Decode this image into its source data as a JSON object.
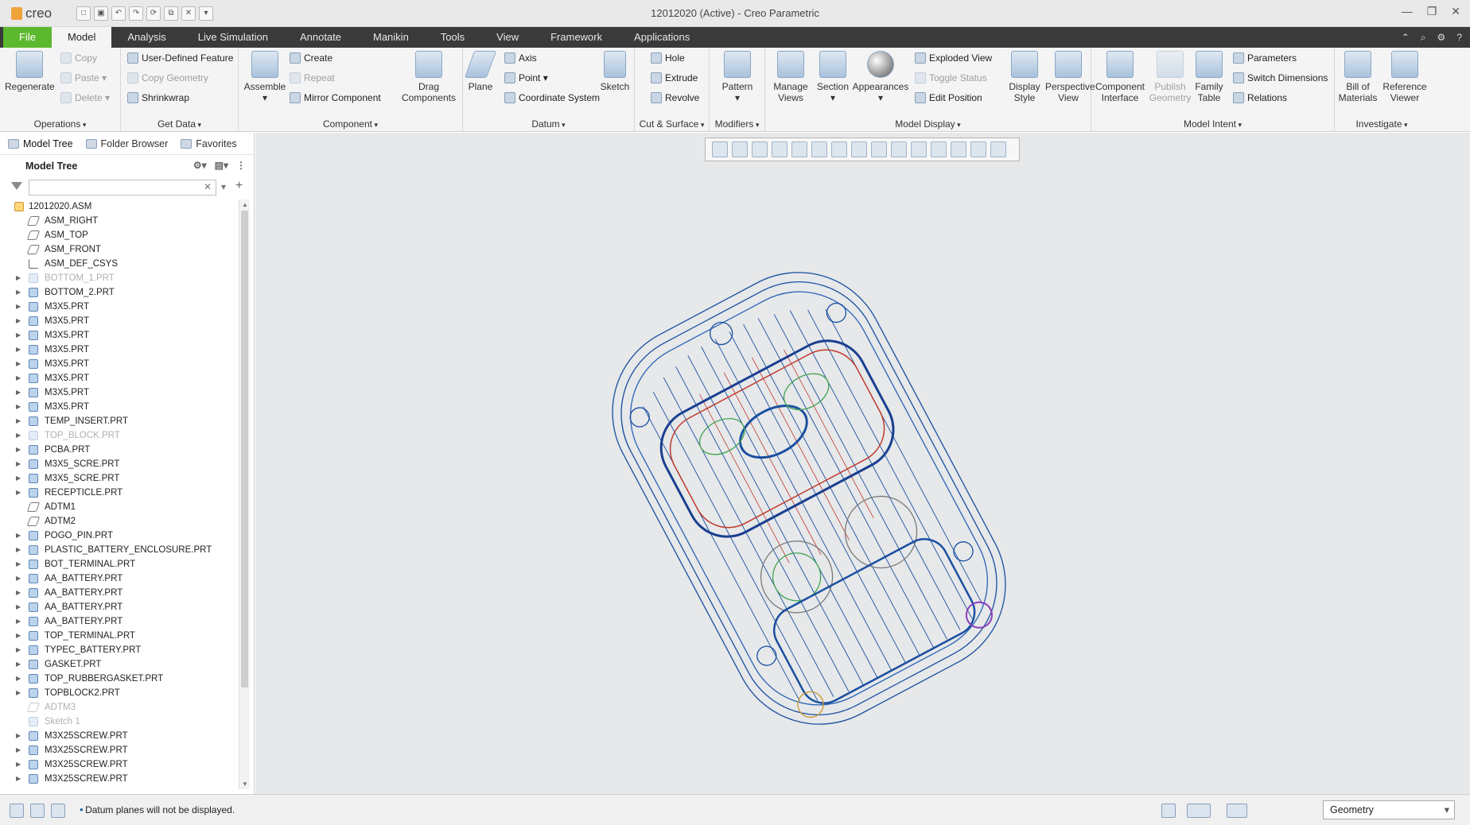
{
  "window": {
    "title": "12012020 (Active) - Creo Parametric",
    "app_name": "creo"
  },
  "tabs": [
    "File",
    "Model",
    "Analysis",
    "Live Simulation",
    "Annotate",
    "Manikin",
    "Tools",
    "View",
    "Framework",
    "Applications"
  ],
  "active_tab": "Model",
  "ribbon": {
    "operations": {
      "label": "Operations",
      "regenerate": "Regenerate",
      "copy": "Copy",
      "paste": "Paste",
      "delete": "Delete"
    },
    "get_data": {
      "label": "Get Data",
      "udf": "User-Defined Feature",
      "copy_geometry": "Copy Geometry",
      "shrinkwrap": "Shrinkwrap"
    },
    "component": {
      "label": "Component",
      "assemble": "Assemble",
      "create": "Create",
      "repeat": "Repeat",
      "mirror": "Mirror Component",
      "drag": "Drag Components"
    },
    "datum": {
      "label": "Datum",
      "plane": "Plane",
      "axis": "Axis",
      "point": "Point",
      "csys": "Coordinate System",
      "sketch": "Sketch"
    },
    "cut_surface": {
      "label": "Cut & Surface",
      "hole": "Hole",
      "extrude": "Extrude",
      "revolve": "Revolve"
    },
    "modifiers": {
      "label": "Modifiers",
      "pattern": "Pattern"
    },
    "model_display": {
      "label": "Model Display",
      "manage_views": "Manage Views",
      "section": "Section",
      "appearances": "Appearances",
      "exploded": "Exploded View",
      "toggle": "Toggle Status",
      "edit_position": "Edit Position",
      "display_style": "Display Style",
      "perspective": "Perspective View"
    },
    "model_intent": {
      "label": "Model Intent",
      "component_interface": "Component Interface",
      "publish_geometry": "Publish Geometry",
      "family_table": "Family Table",
      "parameters": "Parameters",
      "switch_dimensions": "Switch Dimensions",
      "relations": "Relations"
    },
    "investigate": {
      "label": "Investigate",
      "bom": "Bill of Materials",
      "ref_viewer": "Reference Viewer"
    }
  },
  "sidebar": {
    "tabs": [
      "Model Tree",
      "Folder Browser",
      "Favorites"
    ],
    "header": "Model Tree",
    "search_placeholder": "",
    "tree": [
      {
        "label": "12012020.ASM",
        "type": "asm",
        "root": true
      },
      {
        "label": "ASM_RIGHT",
        "type": "plane"
      },
      {
        "label": "ASM_TOP",
        "type": "plane"
      },
      {
        "label": "ASM_FRONT",
        "type": "plane"
      },
      {
        "label": "ASM_DEF_CSYS",
        "type": "csys"
      },
      {
        "label": "BOTTOM_1.PRT",
        "type": "part",
        "dim": true
      },
      {
        "label": "BOTTOM_2.PRT",
        "type": "part"
      },
      {
        "label": "M3X5.PRT",
        "type": "part"
      },
      {
        "label": "M3X5.PRT",
        "type": "part"
      },
      {
        "label": "M3X5.PRT",
        "type": "part"
      },
      {
        "label": "M3X5.PRT",
        "type": "part"
      },
      {
        "label": "M3X5.PRT",
        "type": "part"
      },
      {
        "label": "M3X5.PRT",
        "type": "part"
      },
      {
        "label": "M3X5.PRT",
        "type": "part"
      },
      {
        "label": "M3X5.PRT",
        "type": "part"
      },
      {
        "label": "TEMP_INSERT.PRT",
        "type": "part"
      },
      {
        "label": "TOP_BLOCK.PRT",
        "type": "part",
        "dim": true
      },
      {
        "label": "PCBA.PRT",
        "type": "part"
      },
      {
        "label": "M3X5_SCRE.PRT",
        "type": "part"
      },
      {
        "label": "M3X5_SCRE.PRT",
        "type": "part"
      },
      {
        "label": "RECEPTICLE.PRT",
        "type": "part"
      },
      {
        "label": "ADTM1",
        "type": "plane"
      },
      {
        "label": "ADTM2",
        "type": "plane"
      },
      {
        "label": "POGO_PIN.PRT",
        "type": "part"
      },
      {
        "label": "PLASTIC_BATTERY_ENCLOSURE.PRT",
        "type": "part"
      },
      {
        "label": "BOT_TERMINAL.PRT",
        "type": "part"
      },
      {
        "label": "AA_BATTERY.PRT",
        "type": "part"
      },
      {
        "label": "AA_BATTERY.PRT",
        "type": "part"
      },
      {
        "label": "AA_BATTERY.PRT",
        "type": "part"
      },
      {
        "label": "AA_BATTERY.PRT",
        "type": "part"
      },
      {
        "label": "TOP_TERMINAL.PRT",
        "type": "part"
      },
      {
        "label": "TYPEC_BATTERY.PRT",
        "type": "part"
      },
      {
        "label": "GASKET.PRT",
        "type": "part"
      },
      {
        "label": "TOP_RUBBERGASKET.PRT",
        "type": "part"
      },
      {
        "label": "TOPBLOCK2.PRT",
        "type": "part"
      },
      {
        "label": "ADTM3",
        "type": "plane",
        "dim": true
      },
      {
        "label": "Sketch 1",
        "type": "sketch",
        "dim": true
      },
      {
        "label": "M3X25SCREW.PRT",
        "type": "part"
      },
      {
        "label": "M3X25SCREW.PRT",
        "type": "part"
      },
      {
        "label": "M3X25SCREW.PRT",
        "type": "part"
      },
      {
        "label": "M3X25SCREW.PRT",
        "type": "part"
      }
    ]
  },
  "status": {
    "message": "Datum planes will not be displayed.",
    "filter_value": "Geometry"
  },
  "colors": {
    "file_tab": "#5cb82e",
    "tab_bar": "#3a3a3a",
    "viewport_bg": "#e6e8ea",
    "wire_blue": "#1a4fa0",
    "wire_red": "#c0392b",
    "wire_green": "#3fa34d"
  }
}
